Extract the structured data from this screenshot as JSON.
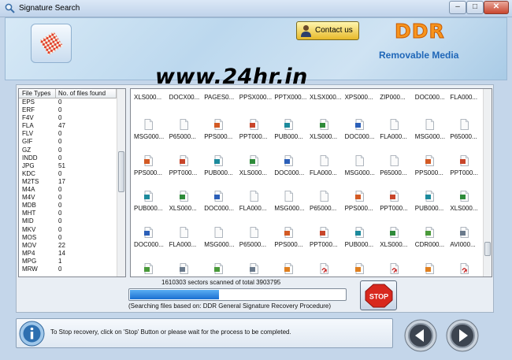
{
  "window": {
    "title": "Signature Search",
    "controls": {
      "minimize": "–",
      "maximize": "□",
      "close": "✕"
    }
  },
  "header": {
    "contact_label": "Contact us",
    "brand": "DDR",
    "subtitle": "Removable Media",
    "watermark": "www.24hr.in"
  },
  "file_types": {
    "col_type": "File Types",
    "col_count": "No. of files found",
    "rows": [
      [
        "EPS",
        "0"
      ],
      [
        "ERF",
        "0"
      ],
      [
        "F4V",
        "0"
      ],
      [
        "FLA",
        "47"
      ],
      [
        "FLV",
        "0"
      ],
      [
        "GIF",
        "0"
      ],
      [
        "GZ",
        "0"
      ],
      [
        "INDD",
        "0"
      ],
      [
        "JPG",
        "51"
      ],
      [
        "KDC",
        "0"
      ],
      [
        "M2TS",
        "17"
      ],
      [
        "M4A",
        "0"
      ],
      [
        "M4V",
        "0"
      ],
      [
        "MDB",
        "0"
      ],
      [
        "MHT",
        "0"
      ],
      [
        "MID",
        "0"
      ],
      [
        "MKV",
        "0"
      ],
      [
        "MOS",
        "0"
      ],
      [
        "MOV",
        "22"
      ],
      [
        "MP4",
        "14"
      ],
      [
        "MPG",
        "1"
      ],
      [
        "MRW",
        "0"
      ]
    ],
    "scroll_fraction": 0.2
  },
  "found_files": [
    [
      "XLS000...",
      "DOCX00...",
      "PAGES0...",
      "PPSX000...",
      "PPTX000...",
      "XLSX000...",
      "XPS000...",
      "ZIP000...",
      "DOC000...",
      "FLA000..."
    ],
    [
      "MSG000...",
      "P65000...",
      "PPS000...",
      "PPT000...",
      "PUB000...",
      "XLS000...",
      "DOC000...",
      "FLA000...",
      "MSG000...",
      "P65000..."
    ],
    [
      "PPS000...",
      "PPT000...",
      "PUB000...",
      "XLS000...",
      "DOC000...",
      "FLA000...",
      "MSG000...",
      "P65000...",
      "PPS000...",
      "PPT000..."
    ],
    [
      "PUB000...",
      "XLS000...",
      "DOC000...",
      "FLA000...",
      "MSG000...",
      "P65000...",
      "PPS000...",
      "PPT000...",
      "PUB000...",
      "XLS000..."
    ],
    [
      "DOC000...",
      "FLA000...",
      "MSG000...",
      "P65000...",
      "PPS000...",
      "PPT000...",
      "PUB000...",
      "XLS000...",
      "CDR000...",
      "AVI000..."
    ],
    [
      "CDR000...",
      "AVI000...",
      "CDR000...",
      "AVI000...",
      "AI0001...",
      "PDF000...",
      "AI0001...",
      "PDF000...",
      "AI0001...",
      "PDF000..."
    ]
  ],
  "icon_colors": {
    "XLS": "#2e8b3a",
    "XLSX": "#2e8b3a",
    "DOC": "#2b5fb8",
    "DOCX": "#2b5fb8",
    "PPS": "#d35a24",
    "PPSX": "#d35a24",
    "PPT": "#c8452a",
    "PPTX": "#c8452a",
    "PUB": "#1c8a9c",
    "PDF": "#c62020",
    "AVI": "#6a7a8c",
    "CDR": "#4a9a3a",
    "AI": "#e08020",
    "MSG": "#9a9a9a",
    "FLA": "#9a9a9a",
    "P65": "#9a9a9a",
    "PAGES": "#9a9a9a",
    "XPS": "#9a9a9a",
    "ZIP": "#9a9a9a"
  },
  "progress": {
    "status": "1610303 sectors scanned of total 3903795",
    "scanned": 1610303,
    "total": 3903795,
    "method": "(Searching files based on:  DDR General Signature Recovery Procedure)"
  },
  "stop_label": "STOP",
  "footer": {
    "message": "To Stop recovery, click on 'Stop' Button or please wait for the process to be completed."
  },
  "icons": {
    "app": "magnifier-icon",
    "logo": "checkered-disk-icon",
    "contact": "person-icon",
    "info": "info-icon",
    "back": "back-arrow-icon",
    "next": "next-arrow-icon"
  }
}
